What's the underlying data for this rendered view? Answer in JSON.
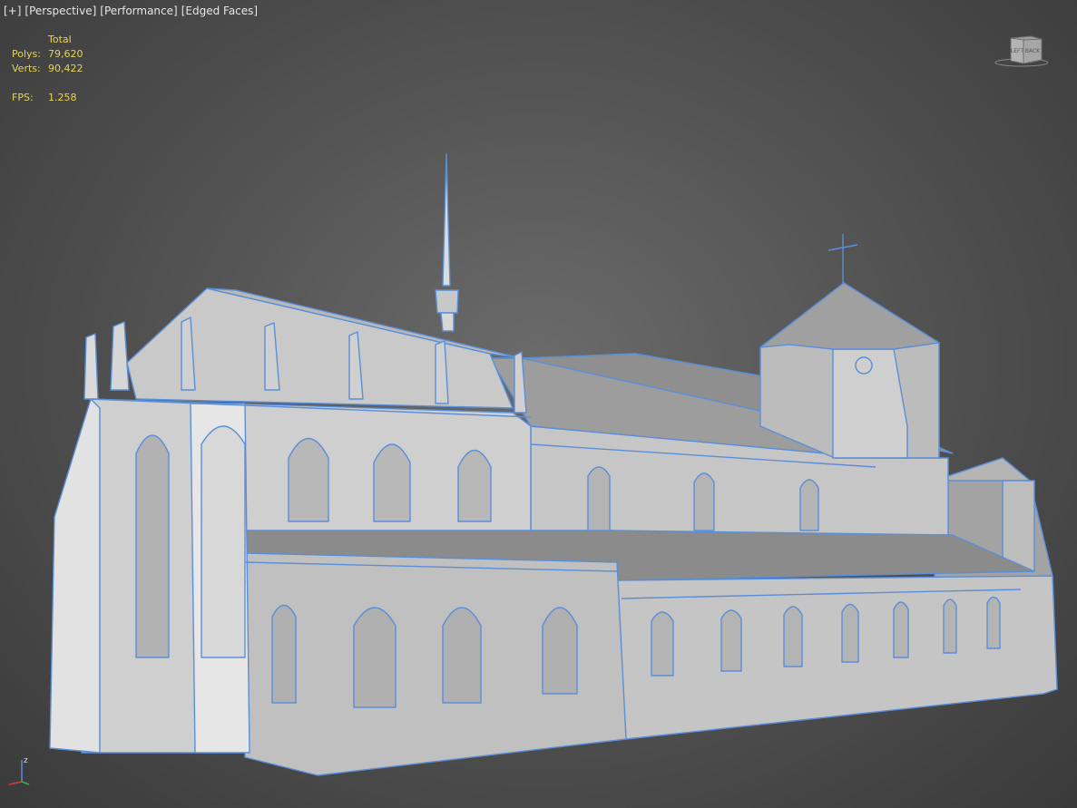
{
  "viewport": {
    "plus": "[+]",
    "view": "[Perspective]",
    "performance": "[Performance]",
    "shading": "[Edged Faces]"
  },
  "stats": {
    "header": "Total",
    "polys_label": "Polys:",
    "polys_value": "79,620",
    "verts_label": "Verts:",
    "verts_value": "90,422",
    "fps_label": "FPS:",
    "fps_value": "1.258"
  },
  "viewcube": {
    "left_face": "LEFT",
    "back_face": "BACK",
    "icon": "viewcube-icon"
  },
  "axis": {
    "z_label": "z",
    "icon": "axis-tripod-icon"
  },
  "colors": {
    "edge": "#5a8fd8",
    "face_light": "#d4d4d4",
    "face_mid": "#b9b9b9",
    "face_dark": "#9a9a9a",
    "stats_text": "#e8d35a"
  },
  "scene": {
    "object": "cathedral-model"
  }
}
